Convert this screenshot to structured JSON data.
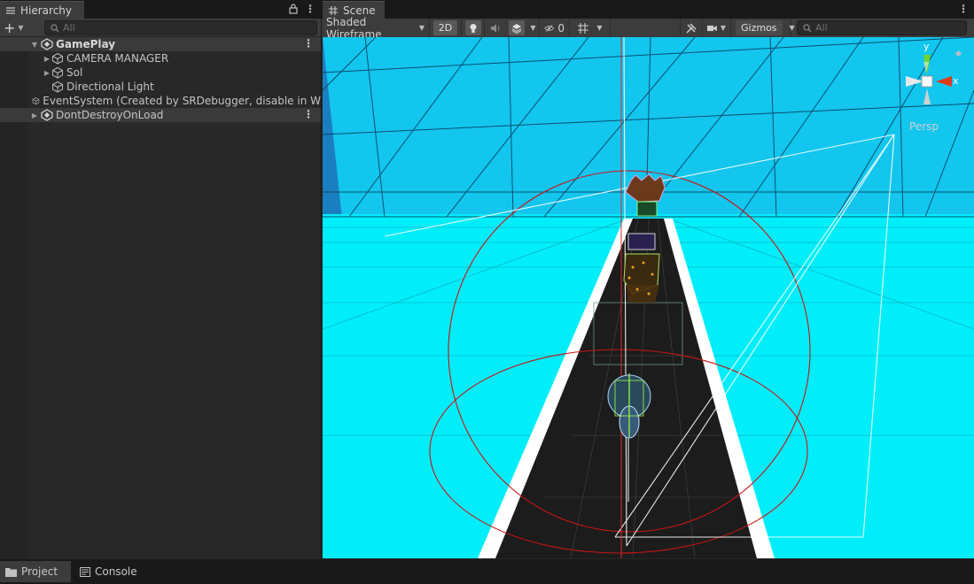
{
  "hierarchy": {
    "tab_label": "Hierarchy",
    "search_placeholder": "All",
    "scenes": [
      {
        "name": "GamePlay",
        "items": [
          {
            "label": "CAMERA MANAGER"
          },
          {
            "label": "Sol"
          },
          {
            "label": "Directional Light"
          },
          {
            "label": "EventSystem (Created by SRDebugger, disable in W"
          }
        ]
      },
      {
        "name": "DontDestroyOnLoad"
      }
    ]
  },
  "scene_view": {
    "tab_label": "Scene",
    "draw_mode": "Shaded Wireframe",
    "mode_2d_label": "2D",
    "hidden_count": "0",
    "gizmos_label": "Gizmos",
    "search_placeholder": "All",
    "gizmo_axes": {
      "y": "y",
      "x": "x"
    },
    "projection_label": "Persp"
  },
  "bottom_tabs": {
    "project_label": "Project",
    "console_label": "Console"
  },
  "colors": {
    "sky": "#00e6f0",
    "road": "#1a1a1a",
    "road_edge": "#ffffff",
    "bounds_circle": "#d01010",
    "gizmo_y": "#6fd42a",
    "gizmo_x": "#e03a1e"
  }
}
